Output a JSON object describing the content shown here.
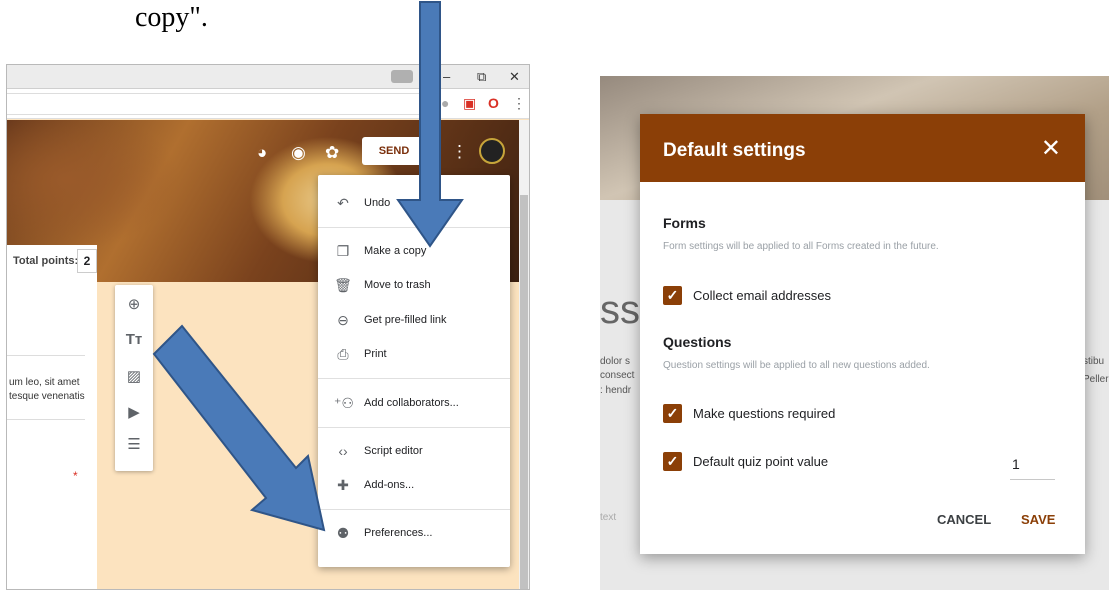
{
  "doc": {
    "caption": "copy\"."
  },
  "left": {
    "window": {
      "minimize": "–",
      "restore": "⧉",
      "close": "✕"
    },
    "header": {
      "send_label": "SEND"
    },
    "form": {
      "total_points_label": "Total points:",
      "total_points_value": "2",
      "snippet_line1": "um leo, sit amet",
      "snippet_line2": "tesque venenatis",
      "required_mark": "*"
    },
    "menu": {
      "items": [
        {
          "icon": "undo-icon",
          "label": "Undo"
        },
        {
          "icon": "copy-icon",
          "label": "Make a copy"
        },
        {
          "icon": "trash-icon",
          "label": "Move to trash"
        },
        {
          "icon": "link-icon",
          "label": "Get pre-filled link"
        },
        {
          "icon": "print-icon",
          "label": "Print"
        },
        {
          "icon": "add-people-icon",
          "label": "Add collaborators..."
        },
        {
          "icon": "code-icon",
          "label": "Script editor"
        },
        {
          "icon": "puzzle-icon",
          "label": "Add-ons..."
        },
        {
          "icon": "preferences-icon",
          "label": "Preferences..."
        }
      ]
    }
  },
  "right": {
    "bg": {
      "big_text": "ssr",
      "left_frag1": "dolor s",
      "left_frag2": "consect",
      "left_frag3": ": hendr",
      "right_frag1": "stibu",
      "right_frag2": "Peller",
      "placeholder_frag": "text"
    },
    "dialog": {
      "title": "Default settings",
      "forms_title": "Forms",
      "forms_sub": "Form settings will be applied to all Forms created in the future.",
      "collect_email_label": "Collect email addresses",
      "questions_title": "Questions",
      "questions_sub": "Question settings will be applied to all new questions added.",
      "make_required_label": "Make questions required",
      "quiz_point_label": "Default quiz point value",
      "quiz_point_value": "1",
      "cancel_label": "CANCEL",
      "save_label": "SAVE"
    }
  },
  "colors": {
    "accent": "#8b3f07",
    "arrow": "#4a7ab8"
  }
}
